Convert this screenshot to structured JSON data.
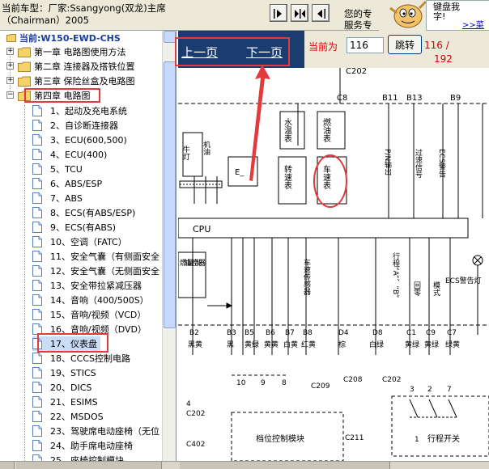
{
  "header": {
    "car_model_label": "当前车型：厂家:Ssangyong(双龙)主席（Chairman）2005",
    "contact_line1": "您的专",
    "contact_line2": "服务专",
    "bubble_line1": "键盘我",
    "bubble_line2": "字!",
    "bubble_link": ">>菜"
  },
  "tree": {
    "root_label": "当前:W150-EWD-CHS",
    "chapters": [
      {
        "label": "第一章 电路图使用方法",
        "expanded": false
      },
      {
        "label": "第二章 连接器及搭铁位置",
        "expanded": false
      },
      {
        "label": "第三章 保险丝盒及电路图",
        "expanded": false
      },
      {
        "label": "第四章 电路图",
        "expanded": true
      }
    ],
    "items": [
      "1、起动及充电系统",
      "2、自诊断连接器",
      "3、ECU(600,500)",
      "4、ECU(400)",
      "5、TCU",
      "6、ABS/ESP",
      "7、ABS",
      "8、ECS(有ABS/ESP)",
      "9、ECS(有ABS)",
      "10、空调（FATC）",
      "11、安全气囊（有侧面安全",
      "12、安全气囊（无侧面安全",
      "13、安全带拉紧减压器",
      "14、音响（400/500S）",
      "15、音响/视频（VCD）",
      "16、音响/视频（DVD）",
      "17、仪表盘",
      "18、CCCS控制电路",
      "19、STICS",
      "20、DICS",
      "21、ESIMS",
      "22、MSDOS",
      "23、驾驶席电动座椅（无位",
      "24、助手席电动座椅",
      "25、座椅控制模块"
    ],
    "selected_index": 16
  },
  "viewer": {
    "prev_label": "上一页",
    "next_label": "下一页",
    "current_label": "当前为",
    "page_value": "116",
    "jump_label": "跳转",
    "page_count_a": "116 /",
    "page_count_b": "192"
  },
  "diagram": {
    "cpu_label": "CPU",
    "top_label": "C202",
    "pin_labels": [
      "C8",
      "B11",
      "B13",
      "B9"
    ],
    "gauges": [
      "水温表",
      "燃油表",
      "转速表",
      "车速表"
    ],
    "e_label": "E_",
    "lamp_left_labels": [
      "牛灯",
      "机油"
    ],
    "right_signal_labels": [
      "P/N输出",
      "过速信号",
      "ECS警告"
    ],
    "ecs_lamp_label": "ECS警告灯",
    "fuel_label": "燃油量控制器",
    "vspeed_label": "车速传感器",
    "trip_label": "行程“A”、“B”",
    "other_vert": [
      "回零",
      "模式"
    ],
    "conn_labels": [
      "B2",
      "B3",
      "B5",
      "B6",
      "B7",
      "B8",
      "D4",
      "D8",
      "C1",
      "C9",
      "C7"
    ],
    "wire_colors": [
      "黑黄",
      "黑",
      "黄绿",
      "黄黄",
      "白黄",
      "红黄",
      "棕",
      "白绿",
      "黄绿",
      "黄绿",
      "绿黄"
    ],
    "bottom_labels": [
      "C202",
      "C209",
      "C208",
      "C202",
      "C211",
      "C402"
    ],
    "pin_numbers": [
      "10",
      "9",
      "8",
      "3",
      "2",
      "4",
      "7",
      "1"
    ],
    "module_label": "档位控制模块",
    "switch_label": "行程开关"
  },
  "colors": {
    "header_bg": "#ece9d8",
    "viewer_bar": "#1a3c6e",
    "annotation": "#e23b3b",
    "tree_root": "#1a3ca0",
    "selected_bg": "#c9ddf5"
  }
}
